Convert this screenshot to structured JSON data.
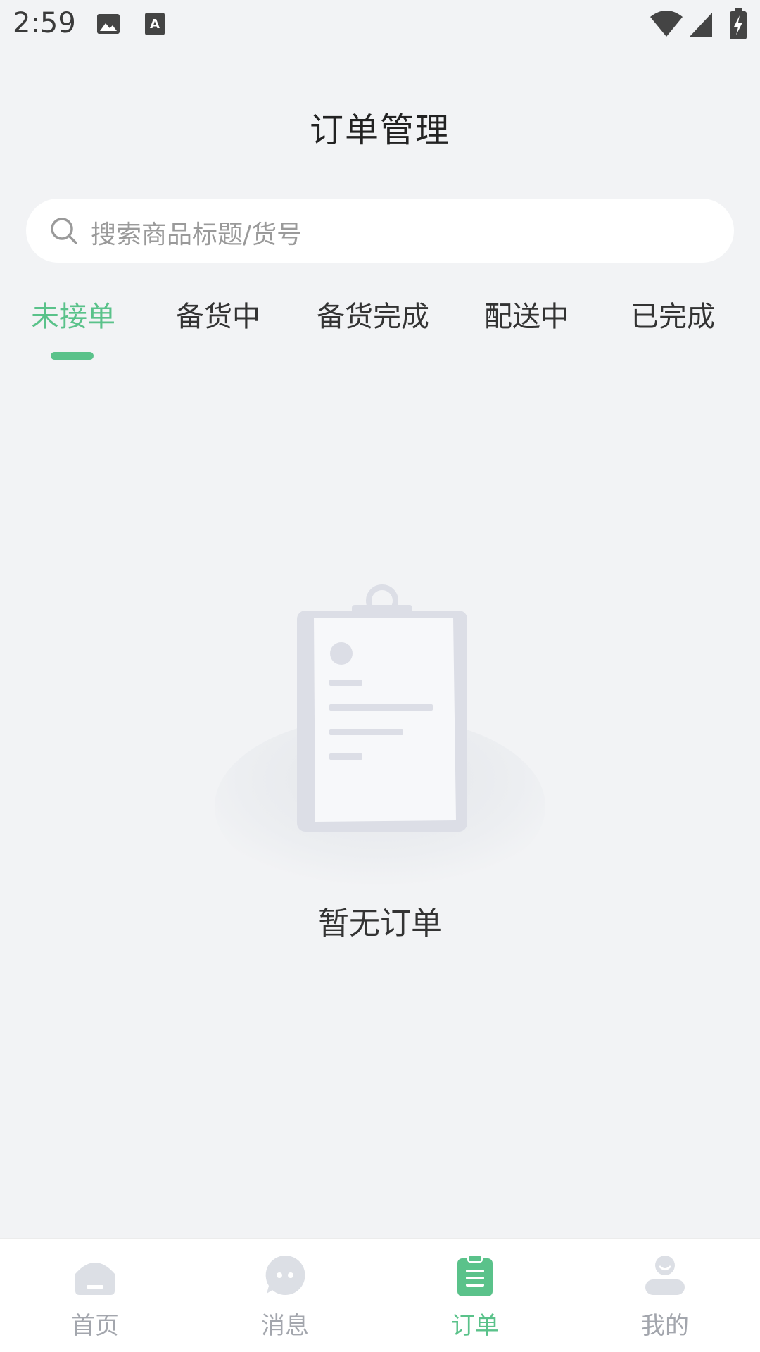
{
  "status_bar": {
    "time": "2:59",
    "icons": [
      "image-icon",
      "keyboard-a-icon",
      "wifi-icon",
      "signal-icon",
      "battery-charging-icon"
    ]
  },
  "header": {
    "title": "订单管理"
  },
  "search": {
    "placeholder": "搜索商品标题/货号"
  },
  "tabs": [
    {
      "label": "未接单",
      "active": true
    },
    {
      "label": "备货中",
      "active": false
    },
    {
      "label": "备货完成",
      "active": false
    },
    {
      "label": "配送中",
      "active": false
    },
    {
      "label": "已完成",
      "active": false
    }
  ],
  "empty_state": {
    "message": "暂无订单"
  },
  "bottom_nav": [
    {
      "label": "首页",
      "icon": "home-icon",
      "active": false
    },
    {
      "label": "消息",
      "icon": "message-icon",
      "active": false
    },
    {
      "label": "订单",
      "icon": "order-clipboard-icon",
      "active": true
    },
    {
      "label": "我的",
      "icon": "user-icon",
      "active": false
    }
  ],
  "colors": {
    "accent": "#5ac28a",
    "background": "#f2f3f5",
    "inactive": "#a3a6ad"
  }
}
